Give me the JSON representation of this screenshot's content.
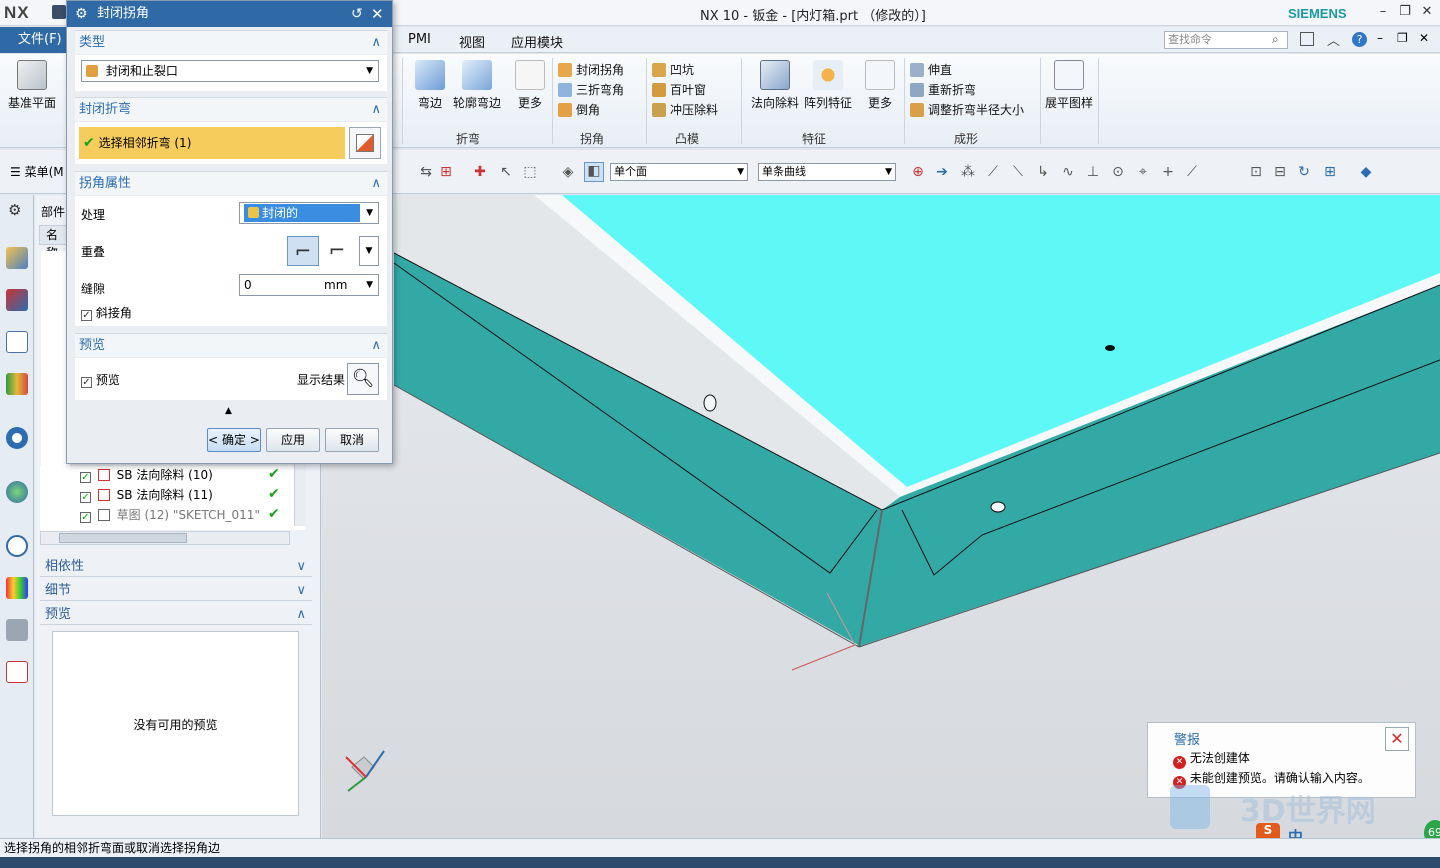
{
  "app": {
    "logo": "NX",
    "title": "NX 10 - 钣金 - [内灯箱.prt （修改的）]",
    "brand": "SIEMENS"
  },
  "menu": {
    "file": "文件(F)",
    "items": [
      "PMI",
      "视图",
      "应用模块"
    ],
    "search_placeholder": "查找命令"
  },
  "ribbon": {
    "datum_plane": "基准平面",
    "flange": "弯边",
    "contour_flange": "轮廓弯边",
    "more": "更多",
    "closed_corner": "封闭拐角",
    "three_bend_corner": "三折弯角",
    "chamfer": "倒角",
    "dimple": "凹坑",
    "louver": "百叶窗",
    "drawn_cutout": "冲压除料",
    "normal_cutout": "法向除料",
    "pattern_feature": "阵列特征",
    "more2": "更多",
    "unbend": "伸直",
    "rebend": "重新折弯",
    "resize_bend_radius": "调整折弯半径大小",
    "flat_pattern": "展平图样",
    "groups": {
      "bend": "折弯",
      "corner": "拐角",
      "punch": "凸模",
      "feature": "特征",
      "form": "成形"
    }
  },
  "toolbar2": {
    "menu": "菜单(M",
    "face_filter": "单个面",
    "curve_rule": "单条曲线"
  },
  "navigator": {
    "header": "部件",
    "col_name": "名称",
    "rows": [
      {
        "label": "SB 法向除料 (10)",
        "checked": true
      },
      {
        "label": "SB 法向除料 (11)",
        "checked": true
      },
      {
        "label": "草图 (12) \"SKETCH_011\"",
        "checked": true
      }
    ],
    "dependencies": "相依性",
    "details": "细节",
    "preview": "预览",
    "no_preview": "没有可用的预览"
  },
  "dialog": {
    "title": "封闭拐角",
    "type_section": "类型",
    "type_value": "封闭和止裂口",
    "closed_bend_section": "封闭折弯",
    "select_bend": "选择相邻折弯 (1)",
    "corner_props_section": "拐角属性",
    "treatment_label": "处理",
    "treatment_value": "封闭的",
    "overlap_label": "重叠",
    "gap_label": "缝隙",
    "gap_value": "0",
    "gap_unit": "mm",
    "miter_label": "斜接角",
    "preview_section": "预览",
    "preview_check": "预览",
    "show_result": "显示结果",
    "ok": "< 确定 >",
    "apply": "应用",
    "cancel": "取消"
  },
  "status": {
    "message": "选择拐角的相邻折弯面或取消选择拐角边"
  },
  "alert": {
    "title": "警报",
    "messages": [
      "无法创建体",
      "未能创建预览。请确认输入内容。"
    ]
  },
  "watermark": "3D世界网",
  "ime": "中",
  "badge": "69",
  "colors": {
    "title_blue": "#2f6aa6",
    "part_top": "#5ef8f6",
    "part_side": "#33a9a6",
    "highlight": "#f6cd5c"
  }
}
